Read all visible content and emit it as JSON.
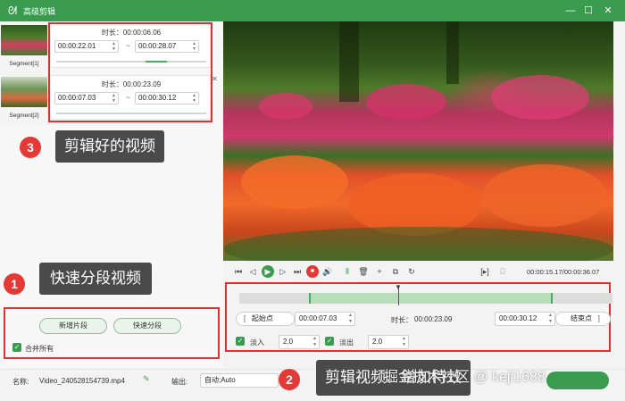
{
  "window": {
    "title": "高级剪辑",
    "icons": {
      "logo": "rabbit-logo-icon",
      "minimize": "minimize-icon",
      "maximize": "maximize-icon",
      "close": "close-icon"
    },
    "accent_color": "#3a9b4f"
  },
  "segments": [
    {
      "label": "Segment[1]",
      "duration_label": "时长：",
      "duration": "00:00:06.06",
      "start": "00:00:22.01",
      "end": "00:00:28.07"
    },
    {
      "label": "Segment[2]",
      "duration_label": "时长：",
      "duration": "00:00:23.09",
      "start": "00:00:07.03",
      "end": "00:00:30.12"
    }
  ],
  "annotations": {
    "a1": {
      "num": "1",
      "text": "快速分段视频"
    },
    "a2": {
      "num": "2",
      "text": "剪辑视频、增加特效"
    },
    "a3": {
      "num": "3",
      "text": "剪辑好的视频"
    }
  },
  "left_actions": {
    "new_segment": "新增片段",
    "quick_split": "快速分段",
    "merge_all": "合并所有"
  },
  "player": {
    "current_time": "00:00:15.17",
    "total_time": "00:00:36.07",
    "separator": "/"
  },
  "trim": {
    "start_label": "起始点",
    "start_value": "00:00:07.03",
    "duration_label": "时长：",
    "duration_value": "00:00:23.09",
    "end_value": "00:00:30.12",
    "end_label": "结束点"
  },
  "effects": {
    "fade_in_label": "淡入",
    "fade_in_value": "2.0",
    "fade_out_label": "淡出",
    "fade_out_value": "2.0"
  },
  "bottom": {
    "name_label": "名称:",
    "filename": "Video_240528154739.mp4",
    "output_label": "输出:",
    "output_value": "自动;Auto"
  },
  "watermark": "掘金技术社区 @ keji1688",
  "colors": {
    "badge": "#e53935",
    "highlight_box": "#e0302f",
    "callout_bg": "#4a4a4a",
    "timeline_sel": "#b8ddb9"
  }
}
